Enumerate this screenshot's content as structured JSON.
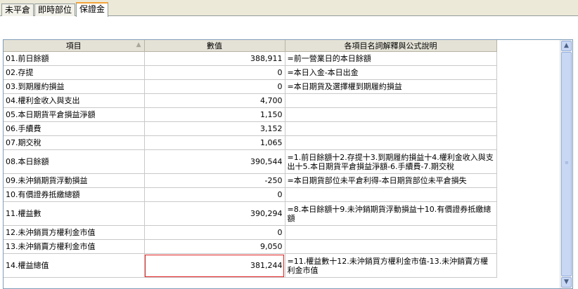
{
  "tabs": [
    {
      "label": "未平倉"
    },
    {
      "label": "即時部位"
    },
    {
      "label": "保證金"
    }
  ],
  "table": {
    "headers": [
      "項目",
      "數值",
      "各項目名詞解釋與公式說明"
    ],
    "rows": [
      {
        "item": "01.前日餘額",
        "value": "388,911",
        "desc": "=前一營業日的本日餘額"
      },
      {
        "item": "02.存提",
        "value": "0",
        "desc": "=本日入金-本日出金"
      },
      {
        "item": "03.到期履約損益",
        "value": "0",
        "desc": "=本日期貨及選擇權到期履約損益"
      },
      {
        "item": "04.權利金收入與支出",
        "value": "4,700",
        "desc": ""
      },
      {
        "item": "05.本日期貨平倉損益淨額",
        "value": "1,150",
        "desc": ""
      },
      {
        "item": "06.手續費",
        "value": "3,152",
        "desc": ""
      },
      {
        "item": "07.期交稅",
        "value": "1,065",
        "desc": ""
      },
      {
        "item": "08.本日餘額",
        "value": "390,544",
        "desc": "=1.前日餘額十2.存提十3.到期履約損益十4.權利金收入與支出十5.本日期貨平倉損益淨額-6.手續費-7.期交稅"
      },
      {
        "item": "09.未沖銷期貨浮動損益",
        "value": "-250",
        "desc": "=本日期貨部位未平倉利得-本日期貨部位未平倉損失"
      },
      {
        "item": "10.有價證券抵繳總額",
        "value": "0",
        "desc": ""
      },
      {
        "item": "11.權益數",
        "value": "390,294",
        "desc": "=8.本日餘額十9.未沖銷期貨浮動損益十10.有價證券抵繳總額"
      },
      {
        "item": "12.未沖銷買方權利金市值",
        "value": "0",
        "desc": ""
      },
      {
        "item": "13.未沖銷賣方權利金市值",
        "value": "9,050",
        "desc": ""
      },
      {
        "item": "14.權益總值",
        "value": "381,244",
        "desc": "=11.權益數十12.未沖銷買方權利金市值-13.未沖銷賣方權利金市值"
      }
    ]
  }
}
